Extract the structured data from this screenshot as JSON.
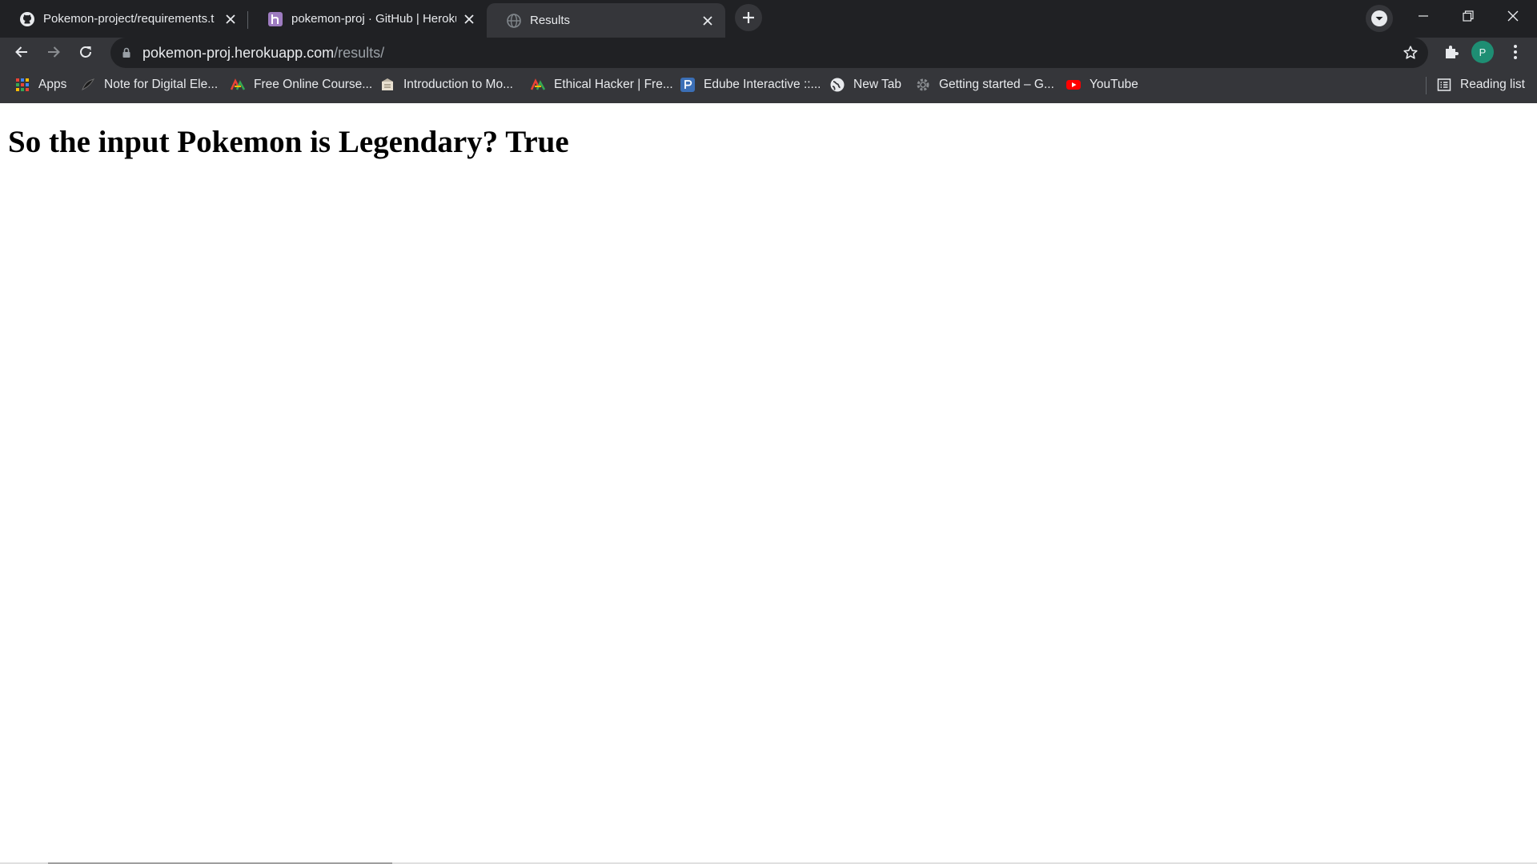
{
  "browser": {
    "tabs": [
      {
        "title": "Pokemon-project/requirements.t",
        "icon": "github-icon",
        "active": false
      },
      {
        "title": "pokemon-proj · GitHub | Heroku",
        "icon": "heroku-icon",
        "active": false
      },
      {
        "title": "Results",
        "icon": "globe-icon",
        "active": true
      }
    ],
    "address_bar": {
      "host": "pokemon-proj.herokuapp.com",
      "path": "/results/"
    },
    "profile_initial": "P",
    "bookmarks": [
      {
        "label": "Apps",
        "icon": "apps-grid-icon"
      },
      {
        "label": "Note for Digital Ele...",
        "icon": "note-icon"
      },
      {
        "label": "Free Online Course...",
        "icon": "course-icon"
      },
      {
        "label": "Introduction to Mo...",
        "icon": "book-icon"
      },
      {
        "label": "Ethical Hacker | Fre...",
        "icon": "course-icon"
      },
      {
        "label": "Edube Interactive ::...",
        "icon": "edube-icon"
      },
      {
        "label": "New Tab",
        "icon": "globe-icon"
      },
      {
        "label": "Getting started – G...",
        "icon": "gear-icon"
      },
      {
        "label": "YouTube",
        "icon": "youtube-icon"
      }
    ],
    "reading_list": "Reading list",
    "colors": {
      "frame": "#202124",
      "toolbar": "#35363a",
      "avatar": "#1e8e73"
    }
  },
  "page": {
    "heading": "So the input Pokemon is Legendary? True"
  }
}
